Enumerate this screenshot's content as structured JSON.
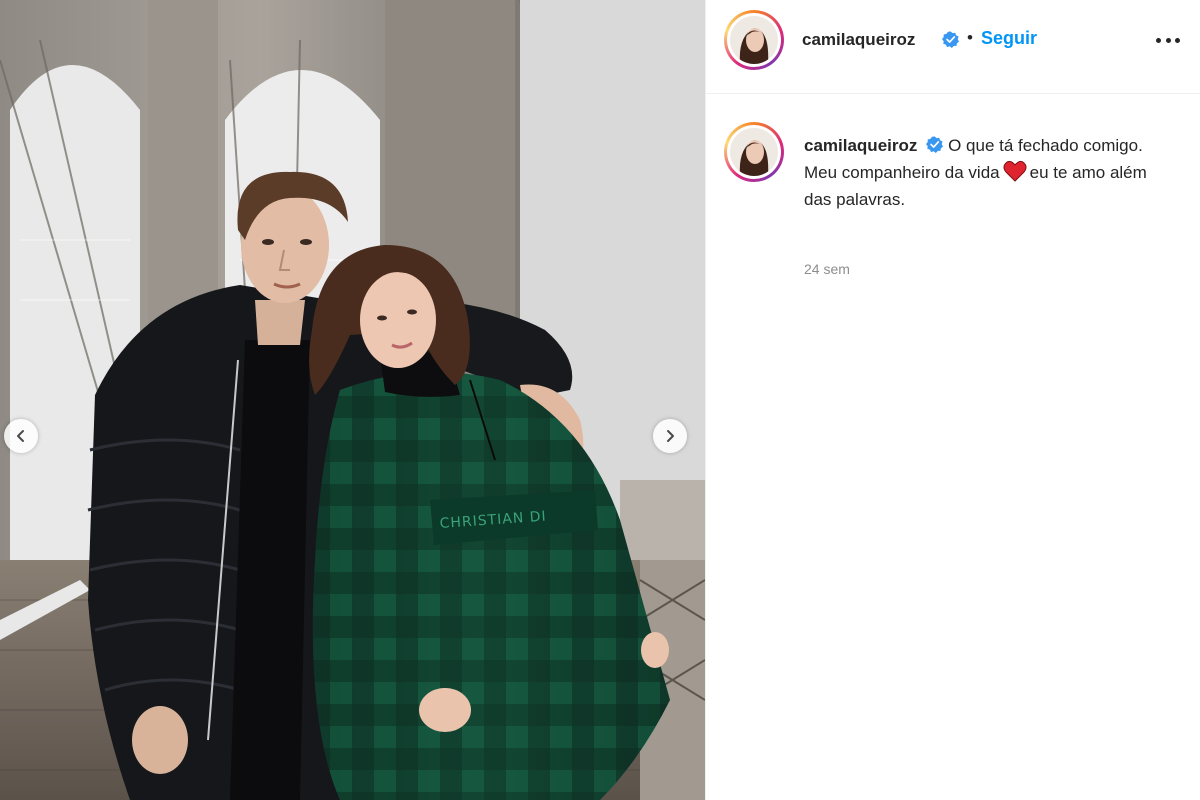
{
  "post": {
    "username": "camilaqueiroz",
    "verified_icon": "verified-badge-icon",
    "separator": "•",
    "follow_label": "Seguir",
    "more_icon": "more-options-icon"
  },
  "caption": {
    "username": "camilaqueiroz",
    "line1": "O que tá fechado comigo.",
    "line2_before": "Meu companheiro da vida",
    "heart_icon": "red-heart-emoji",
    "line2_after": "eu te amo além das palavras.",
    "timestamp": "24 sem"
  },
  "carousel": {
    "prev_icon": "chevron-left-icon",
    "next_icon": "chevron-right-icon"
  },
  "colors": {
    "accent": "#0095f6",
    "text": "#262626",
    "muted": "#8e8e8e",
    "verified": "#3897f0",
    "heart": "#e0242f"
  }
}
